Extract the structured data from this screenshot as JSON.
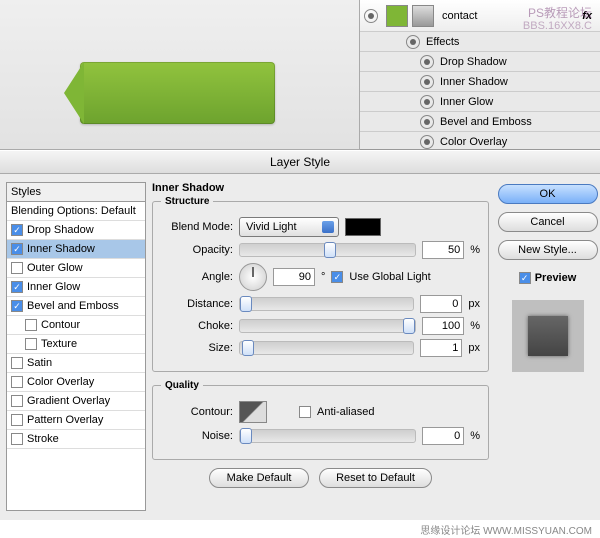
{
  "layers": {
    "name": "contact",
    "effects_label": "Effects",
    "items": [
      "Drop Shadow",
      "Inner Shadow",
      "Inner Glow",
      "Bevel and Emboss",
      "Color Overlay"
    ]
  },
  "watermark": {
    "line1": "PS教程论坛",
    "line2": "BBS.16XX8.C"
  },
  "dialog": {
    "title": "Layer Style",
    "styles_header": "Styles",
    "blending": "Blending Options: Default",
    "list": [
      {
        "label": "Drop Shadow",
        "checked": true,
        "selected": false
      },
      {
        "label": "Inner Shadow",
        "checked": true,
        "selected": true
      },
      {
        "label": "Outer Glow",
        "checked": false,
        "selected": false
      },
      {
        "label": "Inner Glow",
        "checked": true,
        "selected": false
      },
      {
        "label": "Bevel and Emboss",
        "checked": true,
        "selected": false
      },
      {
        "label": "Contour",
        "checked": false,
        "sub": true
      },
      {
        "label": "Texture",
        "checked": false,
        "sub": true
      },
      {
        "label": "Satin",
        "checked": false,
        "selected": false
      },
      {
        "label": "Color Overlay",
        "checked": false,
        "selected": false
      },
      {
        "label": "Gradient Overlay",
        "checked": false,
        "selected": false
      },
      {
        "label": "Pattern Overlay",
        "checked": false,
        "selected": false
      },
      {
        "label": "Stroke",
        "checked": false,
        "selected": false
      }
    ],
    "panel_title": "Inner Shadow",
    "structure": {
      "legend": "Structure",
      "blend_mode_label": "Blend Mode:",
      "blend_mode_value": "Vivid Light",
      "opacity_label": "Opacity:",
      "opacity_value": "50",
      "opacity_unit": "%",
      "angle_label": "Angle:",
      "angle_value": "90",
      "angle_unit": "°",
      "global_light": "Use Global Light",
      "global_light_checked": true,
      "distance_label": "Distance:",
      "distance_value": "0",
      "distance_unit": "px",
      "choke_label": "Choke:",
      "choke_value": "100",
      "choke_unit": "%",
      "size_label": "Size:",
      "size_value": "1",
      "size_unit": "px"
    },
    "quality": {
      "legend": "Quality",
      "contour_label": "Contour:",
      "anti_aliased": "Anti-aliased",
      "anti_checked": false,
      "noise_label": "Noise:",
      "noise_value": "0",
      "noise_unit": "%"
    },
    "make_default": "Make Default",
    "reset_default": "Reset to Default",
    "ok": "OK",
    "cancel": "Cancel",
    "new_style": "New Style...",
    "preview_label": "Preview",
    "preview_checked": true
  },
  "footer": "思缘设计论坛 WWW.MISSYUAN.COM"
}
